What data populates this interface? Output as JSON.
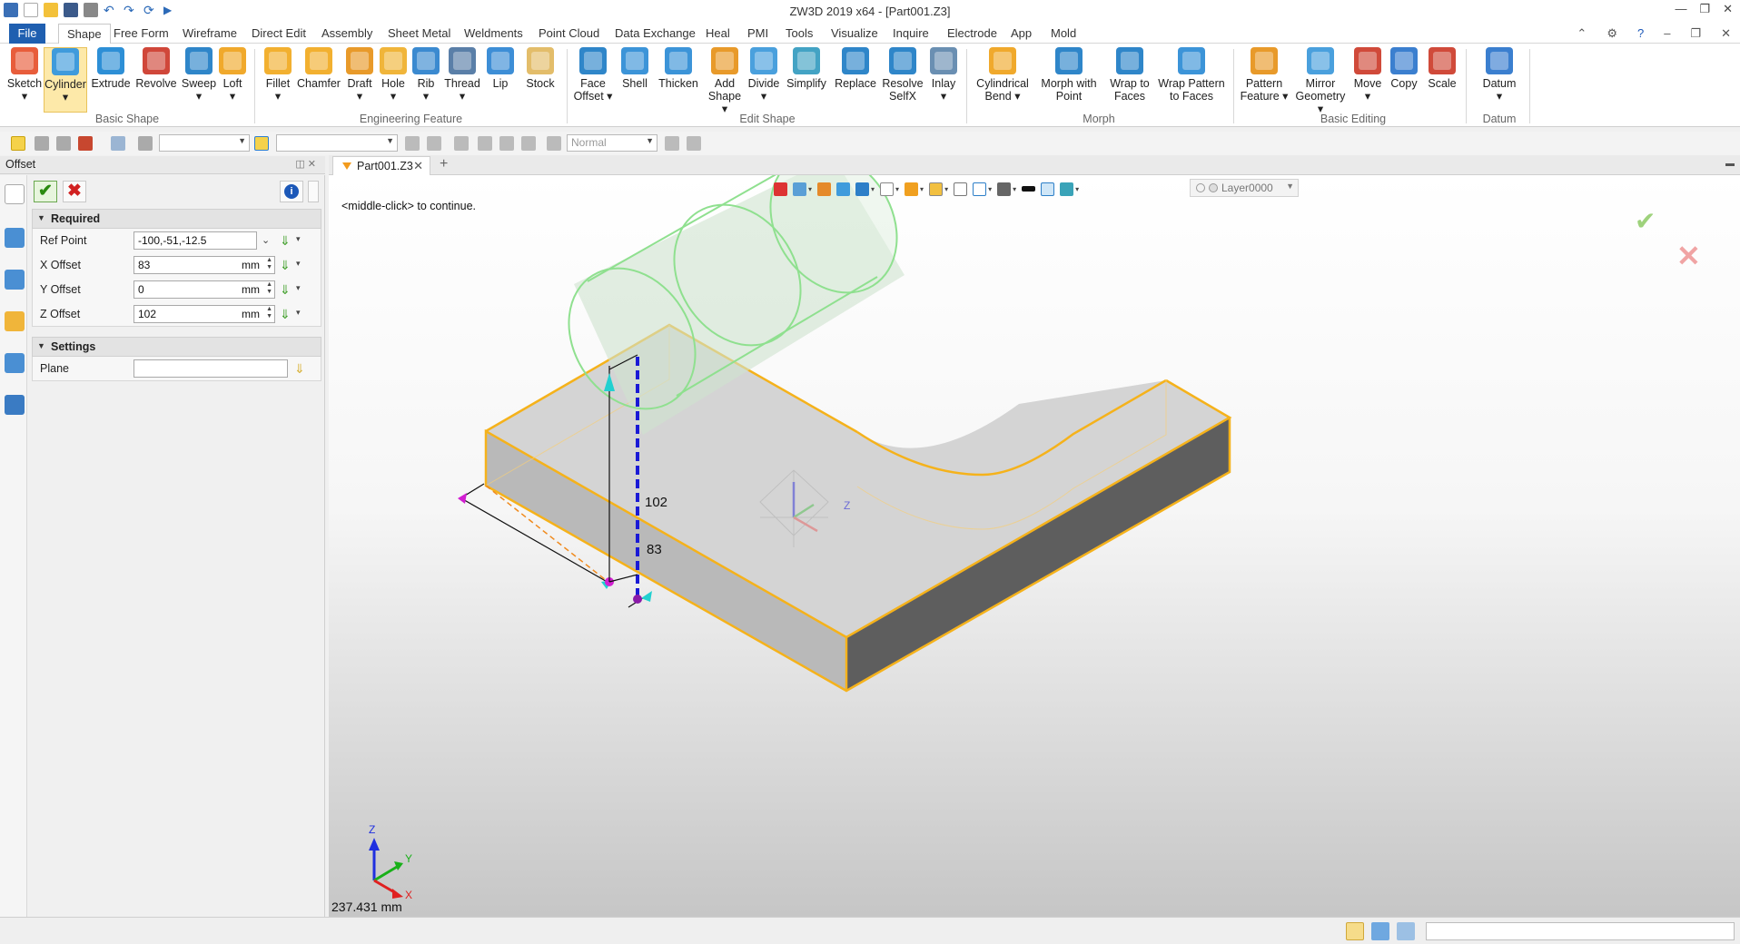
{
  "window": {
    "title": "ZW3D 2019  x64 - [Part001.Z3]"
  },
  "menu": {
    "file": "File",
    "tabs": [
      "Shape",
      "Free Form",
      "Wireframe",
      "Direct Edit",
      "Assembly",
      "Sheet Metal",
      "Weldments",
      "Point Cloud",
      "Data Exchange",
      "Heal",
      "PMI",
      "Tools",
      "Visualize",
      "Inquire",
      "Electrode",
      "App",
      "Mold"
    ]
  },
  "ribbon": {
    "groups": [
      {
        "label": "Basic Shape",
        "items": [
          "Sketch",
          "Cylinder",
          "Extrude",
          "Revolve",
          "Sweep",
          "Loft"
        ]
      },
      {
        "label": "Engineering Feature",
        "items": [
          "Fillet",
          "Chamfer",
          "Draft",
          "Hole",
          "Rib",
          "Thread",
          "Lip",
          "Stock"
        ]
      },
      {
        "label": "Edit Shape",
        "items": [
          "Face Offset",
          "Shell",
          "Thicken",
          "Add Shape",
          "Divide",
          "Simplify",
          "Replace",
          "Resolve SelfX",
          "Inlay"
        ]
      },
      {
        "label": "Morph",
        "items": [
          "Cylindrical Bend",
          "Morph with Point",
          "Wrap to Faces",
          "Wrap Pattern to Faces"
        ]
      },
      {
        "label": "Basic Editing",
        "items": [
          "Pattern Feature",
          "Mirror Geometry",
          "Move",
          "Copy",
          "Scale"
        ]
      },
      {
        "label": "Datum",
        "items": [
          "Datum"
        ]
      }
    ]
  },
  "toolbar2": {
    "mode": "Normal"
  },
  "panel": {
    "title": "Offset",
    "required_label": "Required",
    "settings_label": "Settings",
    "fields": {
      "ref_point": {
        "label": "Ref Point",
        "value": "-100,-51,-12.5"
      },
      "x_offset": {
        "label": "X Offset",
        "value": "83",
        "unit": "mm"
      },
      "y_offset": {
        "label": "Y Offset",
        "value": "0",
        "unit": "mm"
      },
      "z_offset": {
        "label": "Z Offset",
        "value": "102",
        "unit": "mm"
      },
      "plane": {
        "label": "Plane",
        "value": ""
      }
    }
  },
  "document": {
    "tab": "Part001.Z3"
  },
  "viewport": {
    "prompt": "<middle-click> to continue.",
    "layer": "Layer0000",
    "dim_x": "83",
    "dim_z": "102",
    "measurement": "237.431 mm",
    "axis_labels": {
      "x": "X",
      "y": "Y",
      "z": "Z"
    }
  },
  "colors": {
    "accent": "#1f5fb0",
    "selection_edge": "#f5b21b",
    "cylinder_edge": "#8fe08f",
    "dim_line": "#1a1ad6",
    "handle": "#d21fd2"
  }
}
